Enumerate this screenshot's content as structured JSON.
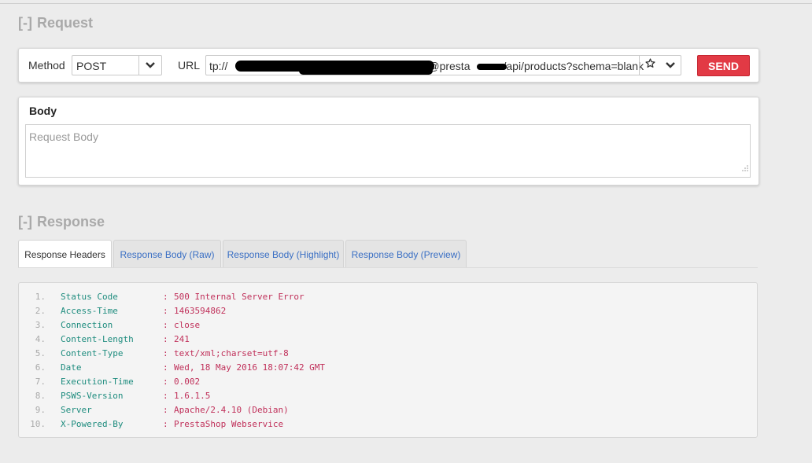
{
  "request": {
    "title": "Request",
    "toggle": "[-]",
    "method_label": "Method",
    "method_value": "POST",
    "url_label": "URL",
    "url_prefix": "tp://",
    "url_mid": "@presta",
    "url_suffix": "/api/products?schema=blank",
    "send_label": "SEND"
  },
  "body": {
    "title": "Body",
    "placeholder": "Request Body"
  },
  "response": {
    "title": "Response",
    "toggle": "[-]",
    "tabs": [
      {
        "label": "Response Headers",
        "active": true
      },
      {
        "label": "Response Body (Raw)",
        "active": false
      },
      {
        "label": "Response Body (Highlight)",
        "active": false
      },
      {
        "label": "Response Body (Preview)",
        "active": false
      }
    ],
    "headers": [
      {
        "num": "1.",
        "key": "Status Code",
        "value": "500 Internal Server Error"
      },
      {
        "num": "2.",
        "key": "Access-Time",
        "value": "1463594862"
      },
      {
        "num": "3.",
        "key": "Connection",
        "value": "close"
      },
      {
        "num": "4.",
        "key": "Content-Length",
        "value": "241"
      },
      {
        "num": "5.",
        "key": "Content-Type",
        "value": "text/xml;charset=utf-8"
      },
      {
        "num": "6.",
        "key": "Date",
        "value": "Wed, 18 May 2016 18:07:42 GMT"
      },
      {
        "num": "7.",
        "key": "Execution-Time",
        "value": "0.002"
      },
      {
        "num": "8.",
        "key": "PSWS-Version",
        "value": "1.6.1.5"
      },
      {
        "num": "9.",
        "key": "Server",
        "value": "Apache/2.4.10 (Debian)"
      },
      {
        "num": "10.",
        "key": "X-Powered-By",
        "value": "PrestaShop Webservice"
      }
    ],
    "separator": ":"
  },
  "colors": {
    "send": "#e23a45",
    "key": "#1e8c7e",
    "value": "#c0305a",
    "tab_link": "#3a6fc4"
  }
}
